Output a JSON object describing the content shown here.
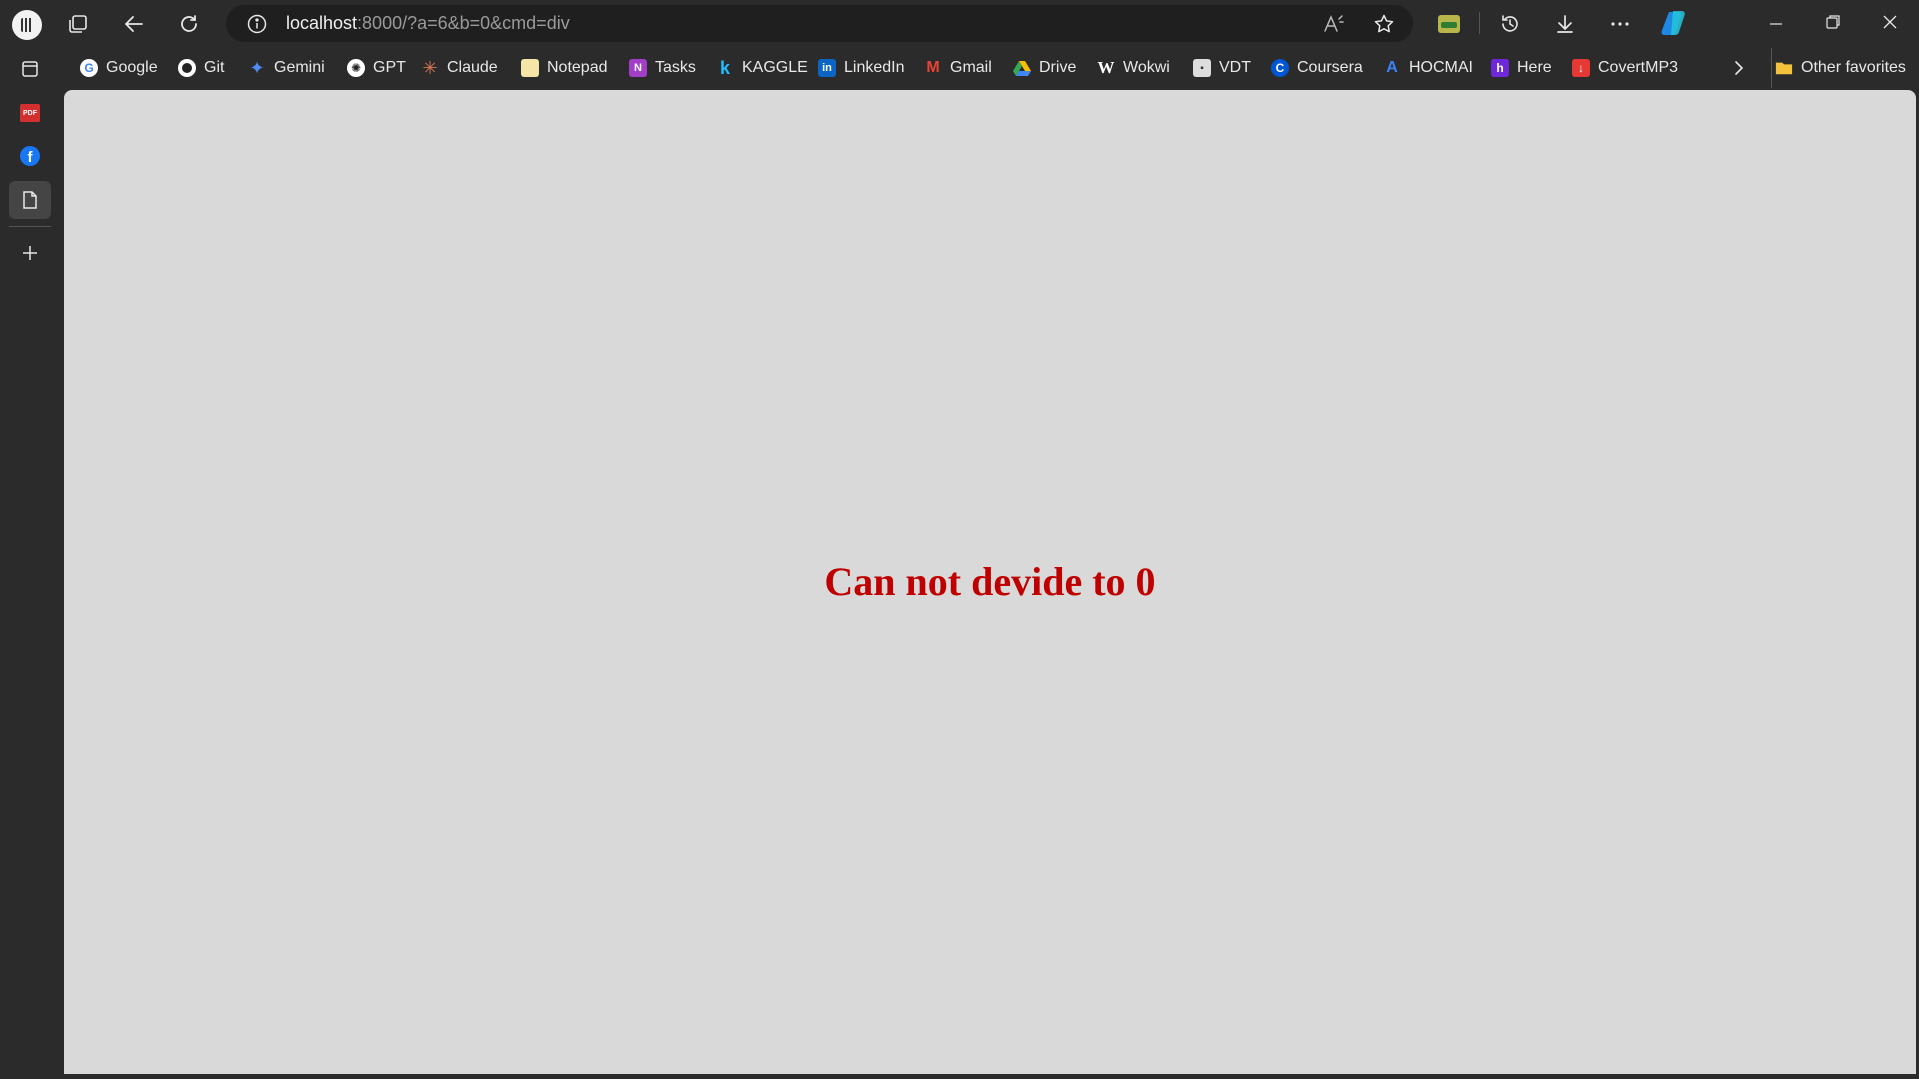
{
  "address_bar": {
    "host": "localhost",
    "path": ":8000/?a=6&b=0&cmd=div"
  },
  "bookmarks": [
    {
      "label": "Google",
      "icon": "google-icon",
      "color": "#4285f4"
    },
    {
      "label": "Git",
      "icon": "github-icon",
      "color": "#ffffff"
    },
    {
      "label": "Gemini",
      "icon": "gemini-icon",
      "color": "#4f8df5"
    },
    {
      "label": "GPT",
      "icon": "openai-icon",
      "color": "#ffffff"
    },
    {
      "label": "Claude",
      "icon": "claude-icon",
      "color": "#d97757"
    },
    {
      "label": "Notepad",
      "icon": "notepad-icon",
      "color": "#f5e6a8"
    },
    {
      "label": "Tasks",
      "icon": "onenote-icon",
      "color": "#a23ec7"
    },
    {
      "label": "KAGGLE",
      "icon": "kaggle-icon",
      "color": "#20beff"
    },
    {
      "label": "LinkedIn",
      "icon": "linkedin-icon",
      "color": "#0a66c2"
    },
    {
      "label": "Gmail",
      "icon": "gmail-icon",
      "color": "#ea4335"
    },
    {
      "label": "Drive",
      "icon": "drive-icon",
      "color": "#34a853"
    },
    {
      "label": "Wokwi",
      "icon": "wokwi-icon",
      "color": "#ffffff"
    },
    {
      "label": "VDT",
      "icon": "vdt-icon",
      "color": "#dddddd"
    },
    {
      "label": "Coursera",
      "icon": "coursera-icon",
      "color": "#0056d2"
    },
    {
      "label": "HOCMAI",
      "icon": "hocmai-icon",
      "color": "#3b82f6"
    },
    {
      "label": "Here",
      "icon": "here-icon",
      "color": "#6d28d9"
    },
    {
      "label": "CovertMP3",
      "icon": "convertmp3-icon",
      "color": "#e53935"
    }
  ],
  "other_favorites": "Other favorites",
  "page": {
    "message": "Can not devide to 0",
    "message_color": "#c00000",
    "background": "#d9d9d9"
  }
}
